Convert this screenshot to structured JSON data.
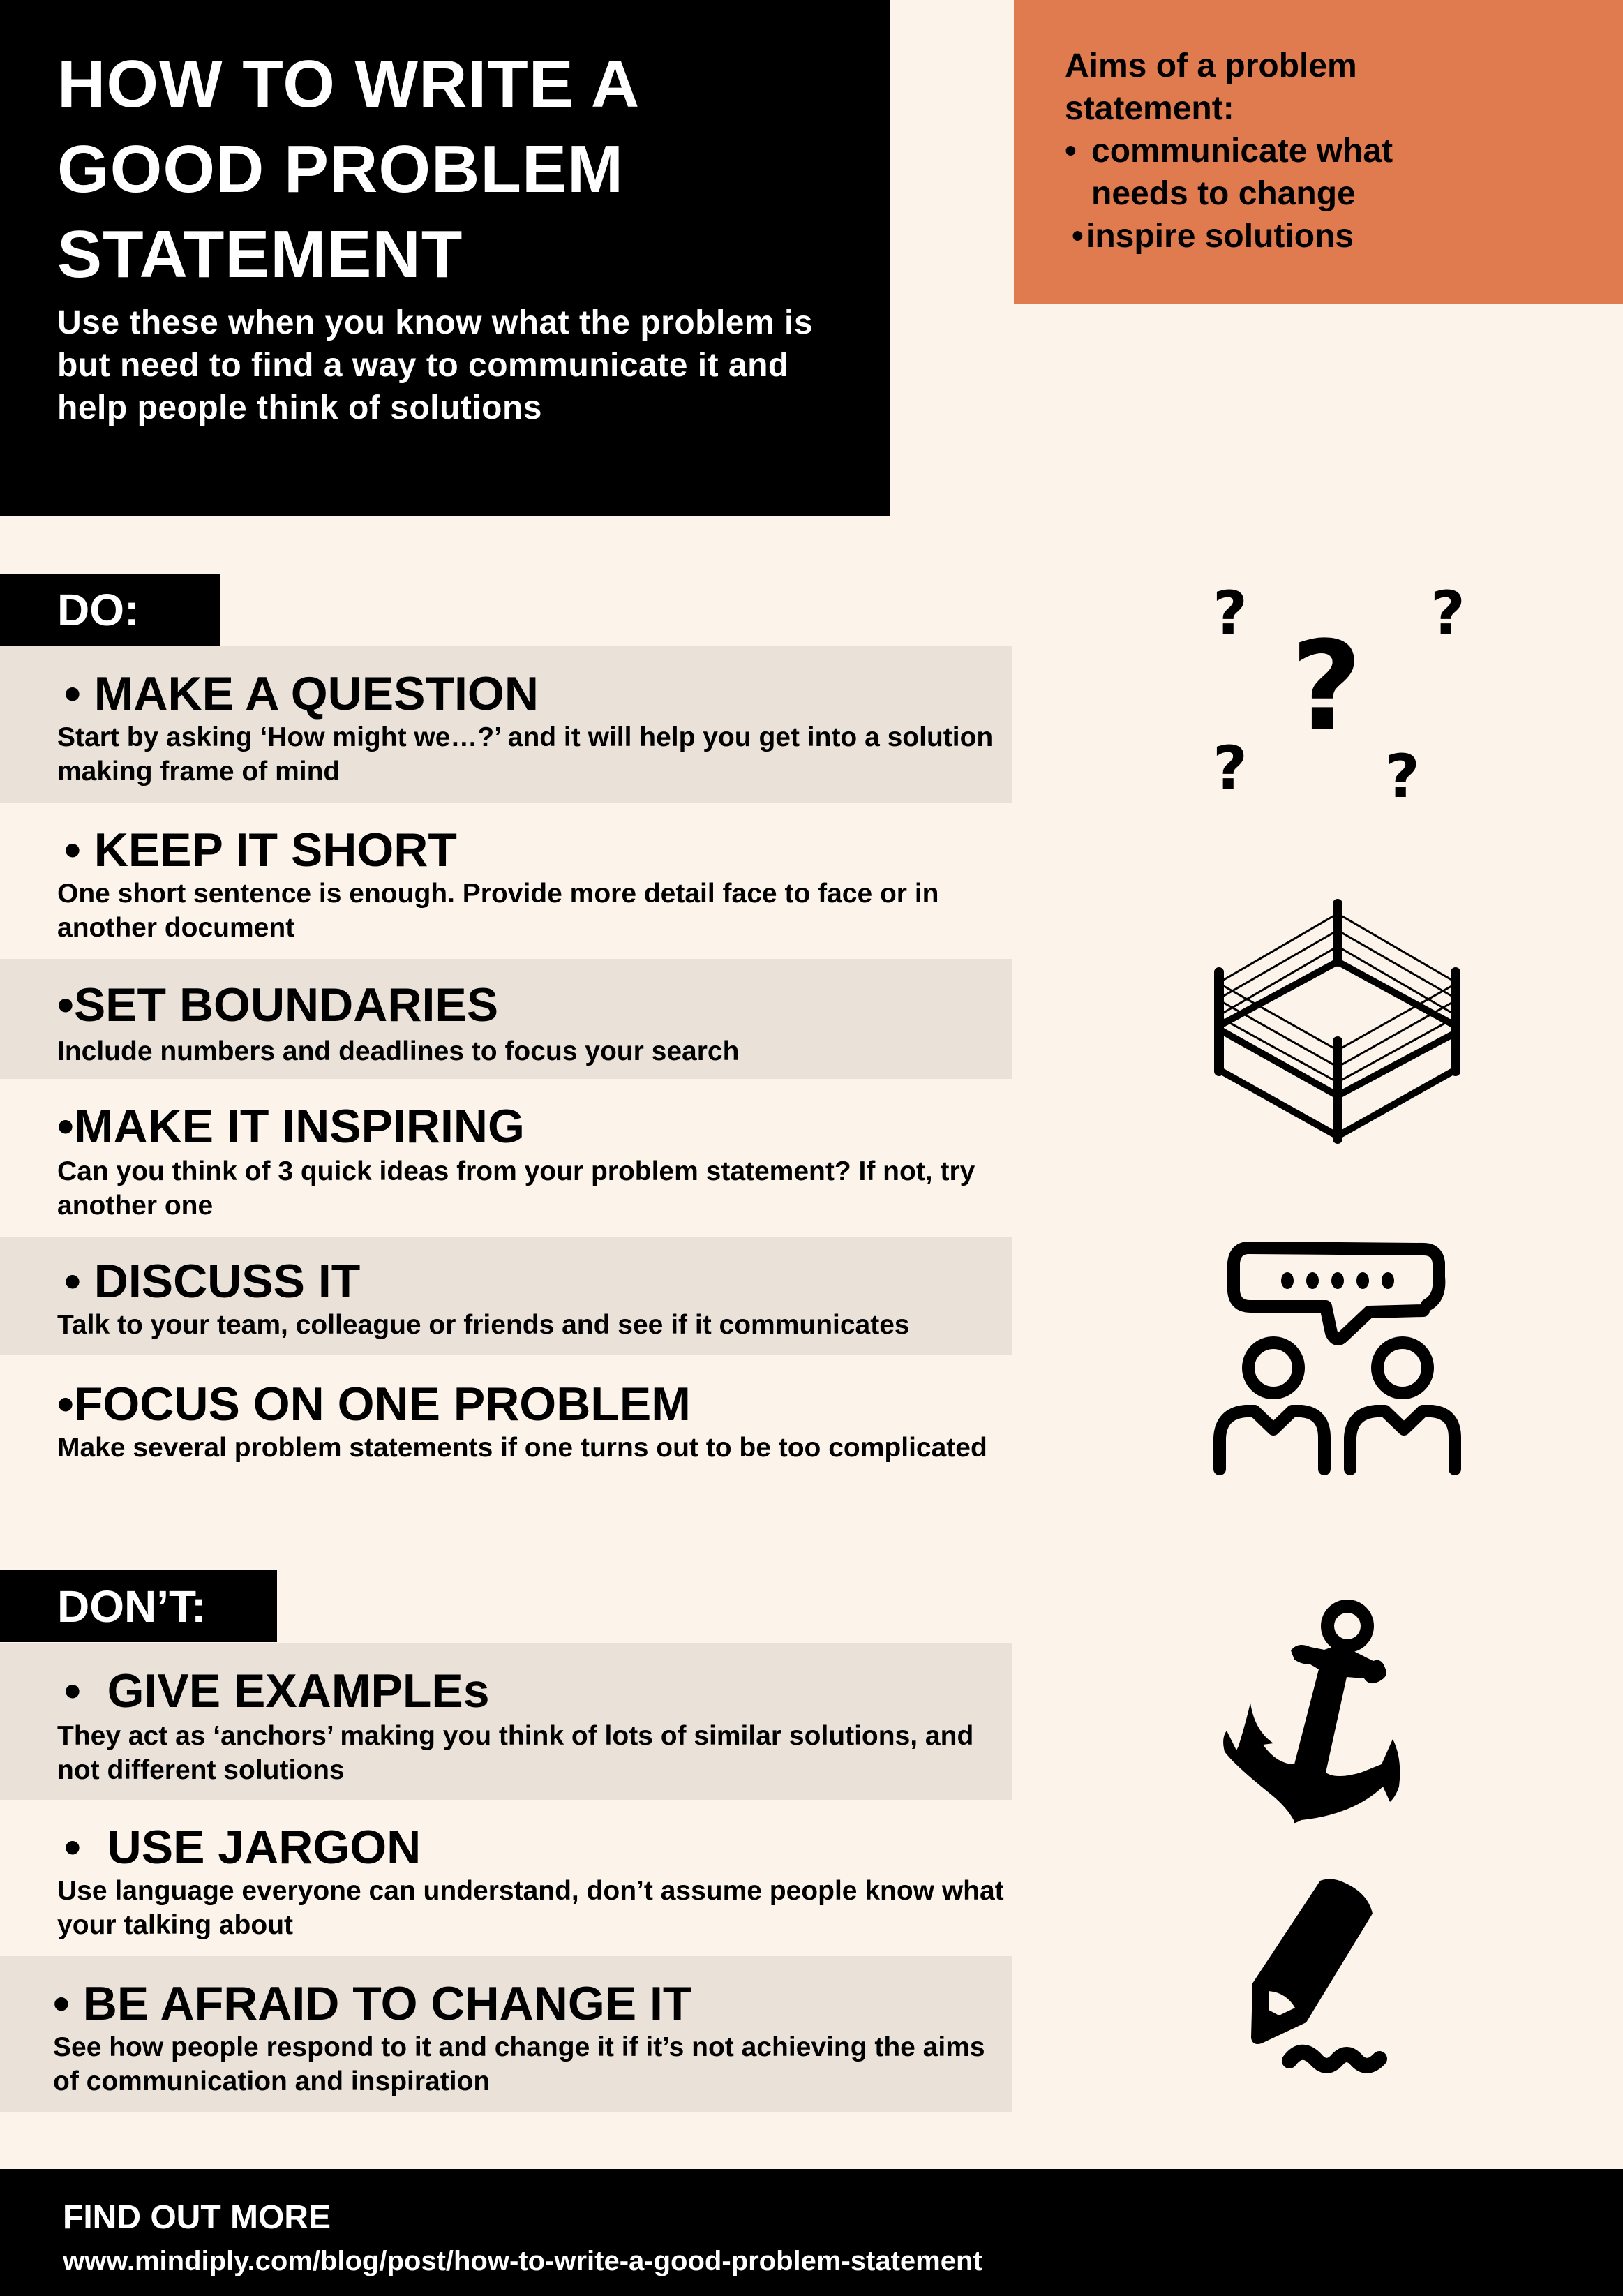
{
  "header": {
    "title_lines": [
      "HOW TO WRITE A",
      "GOOD PROBLEM",
      "STATEMENT"
    ],
    "subtitle": "Use these when you know what the problem is but need to find a way to communicate it and help people think of solutions"
  },
  "aims": {
    "title_lines": [
      "Aims of a problem",
      "statement:"
    ],
    "items": [
      {
        "bullet": "•",
        "lines": [
          "communicate what",
          "needs to change"
        ]
      },
      {
        "bullet": "•",
        "lines": [
          "inspire solutions"
        ]
      }
    ]
  },
  "do_section": {
    "label": "DO:",
    "items": [
      {
        "bullet": "•",
        "heading": "MAKE A QUESTION",
        "desc": "Start by asking ‘How might we…?’ and it will help you get into a solution making frame of mind"
      },
      {
        "bullet": "•",
        "heading": "KEEP IT SHORT",
        "desc": "One short sentence is enough. Provide more detail face to face or in another document"
      },
      {
        "bullet": "•",
        "heading": "SET BOUNDARIES",
        "desc": "Include numbers and deadlines to focus your search"
      },
      {
        "bullet": "•",
        "heading": "MAKE IT INSPIRING",
        "desc": "Can you think of 3 quick ideas from your problem statement? If not, try another one"
      },
      {
        "bullet": "•",
        "heading": "DISCUSS IT",
        "desc": "Talk to your team, colleague or friends and see if it communicates"
      },
      {
        "bullet": "•",
        "heading": "FOCUS ON ONE PROBLEM",
        "desc": "Make several problem statements if one turns out to be too complicated"
      }
    ]
  },
  "dont_section": {
    "label": "DON’T:",
    "items": [
      {
        "bullet": "•",
        "heading": "GIVE EXAMPLEs",
        "desc": "They act as ‘anchors’ making you think of lots of similar solutions, and not different solutions"
      },
      {
        "bullet": "•",
        "heading": "USE JARGON",
        "desc": "Use language everyone can understand, don’t assume people know what your talking about"
      },
      {
        "bullet": "•",
        "heading": "BE AFRAID TO CHANGE IT",
        "desc": "See how people respond to it and change it if it’s not achieving the aims of communication and inspiration"
      }
    ]
  },
  "icons": {
    "question_glyph": "?",
    "items": [
      "question-marks-icon",
      "boxing-ring-icon",
      "discussion-icon",
      "anchor-icon",
      "pencil-icon"
    ]
  },
  "footer": {
    "title": "FIND OUT MORE",
    "link": "www.mindiply.com/blog/post/how-to-write-a-good-problem-statement"
  },
  "colors": {
    "background": "#fcf4ea",
    "accent_orange": "#e07a4f",
    "shaded_row": "#eae2d9",
    "dark": "#000000"
  }
}
